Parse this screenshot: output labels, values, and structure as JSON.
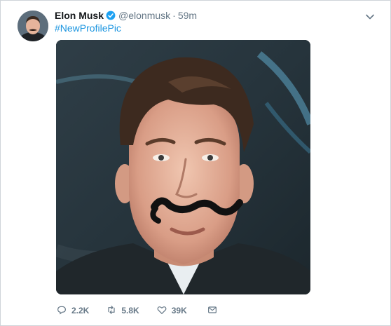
{
  "tweet": {
    "author_name": "Elon Musk",
    "handle": "@elonmusk",
    "separator": "·",
    "time": "59m",
    "hashtag": "#NewProfilePic",
    "replies": "2.2K",
    "retweets": "5.8K",
    "likes": "39K",
    "icons": {
      "verified": "verified-badge-icon",
      "menu": "chevron-down-icon",
      "reply": "reply-icon",
      "retweet": "retweet-icon",
      "like": "heart-icon",
      "message": "envelope-icon"
    },
    "colors": {
      "link": "#1b95e0",
      "verified": "#1da1f2",
      "muted": "#657786"
    }
  }
}
